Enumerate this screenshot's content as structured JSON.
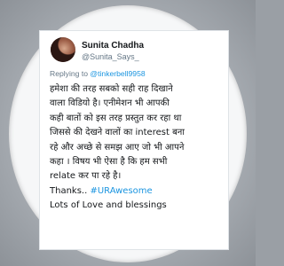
{
  "tweet": {
    "author_name": "Sunita Chadha",
    "handle": "@Sunita_Says_",
    "reply_prefix": "Replying to ",
    "reply_to": "@tinkerbell9958",
    "lines": [
      "हमेशा की तरह सबको सही राह दिखाने",
      "वाला विडियो है। एनीमेशन भी आपकी",
      "कही बातों को इस तरह प्रस्तुत कर रहा था",
      "जिससे की देखने वालों का interest  बना",
      "रहे और अच्छे से समझ आए जो भी आपने",
      "कहा । विषय भी ऐसा है कि हम सभी",
      "relate  कर पा रहे है।"
    ],
    "thanks_text": "Thanks.. ",
    "hashtag": "#URAwesome",
    "closing": "Lots of Love and blessings"
  },
  "colors": {
    "link": "#1b95e0",
    "text": "#14171a",
    "muted": "#657786"
  }
}
